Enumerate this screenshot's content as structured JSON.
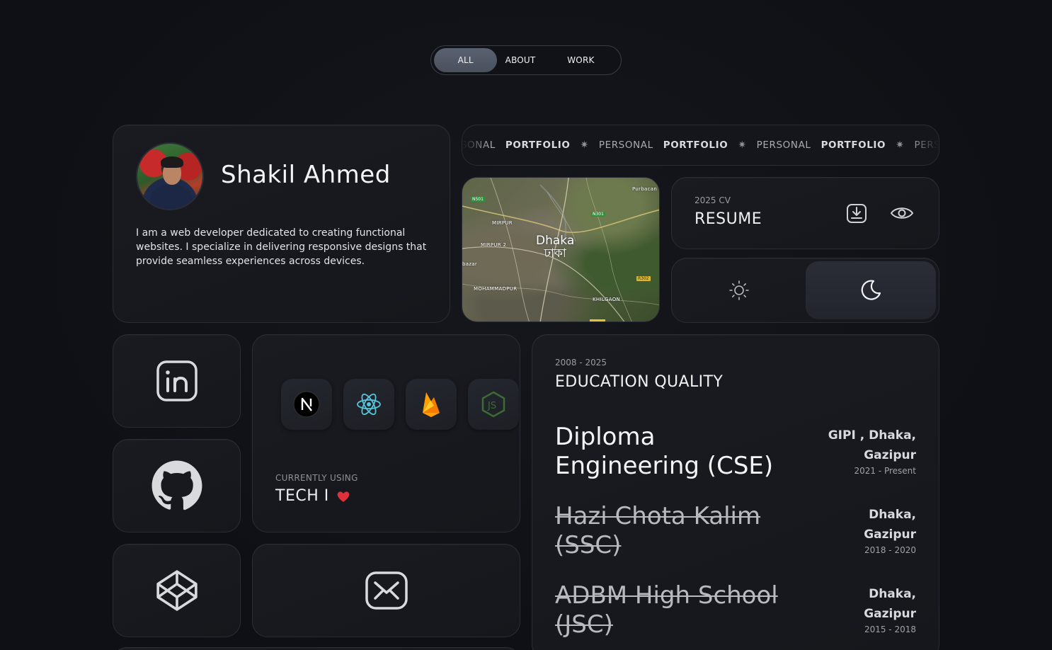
{
  "nav": {
    "items": [
      {
        "label": "ALL",
        "active": true
      },
      {
        "label": "ABOUT",
        "active": false
      },
      {
        "label": "WORK",
        "active": false
      }
    ]
  },
  "profile": {
    "name": "Shakil Ahmed",
    "bio": "I am a web developer dedicated to creating functional websites. I specialize in delivering responsive designs that provide seamless experiences across devices."
  },
  "marquee": {
    "segments": [
      {
        "a": "PERSONAL",
        "b": "PORTFOLIO"
      },
      {
        "a": "PERSONAL",
        "b": "PORTFOLIO"
      },
      {
        "a": "PERSONAL",
        "b": "PORTFOLIO"
      },
      {
        "a": "PERSONAL",
        "b": ""
      }
    ]
  },
  "map": {
    "city_en": "Dhaka",
    "city_bn": "ঢাকা",
    "labels": [
      "Purbacan",
      "MIRPUR",
      "MIRPUR 2",
      "bazar",
      "MOHAMMADPUR",
      "KHILGAON"
    ],
    "road_tags": [
      "N501",
      "N301",
      "R302"
    ]
  },
  "resume": {
    "subtitle": "2025 CV",
    "title": "RESUME",
    "download_icon": "download-icon",
    "view_icon": "eye-icon"
  },
  "theme": {
    "light_icon": "sun-icon",
    "dark_icon": "moon-icon",
    "active": "dark"
  },
  "socials": [
    {
      "name": "linkedin-icon"
    },
    {
      "name": "github-icon"
    },
    {
      "name": "codepen-icon"
    },
    {
      "name": "mail-icon"
    }
  ],
  "tech": {
    "subtitle": "CURRENTLY USING",
    "title": "TECH I",
    "icons": [
      "nextjs-icon",
      "react-icon",
      "firebase-icon",
      "nodejs-icon"
    ]
  },
  "education": {
    "subtitle": "2008 - 2025",
    "title": "EDUCATION QUALITY",
    "entries": [
      {
        "name": "Diploma Engineering (CSE)",
        "place_line1": "GIPI , Dhaka,",
        "place_line2": "Gazipur",
        "years": "2021 - Present",
        "struck": false
      },
      {
        "name": "Hazi Chota Kalim (SSC)",
        "place_line1": "Dhaka,",
        "place_line2": "Gazipur",
        "years": "2018 - 2020",
        "struck": true
      },
      {
        "name": "ADBM High School (JSC)",
        "place_line1": "Dhaka,",
        "place_line2": "Gazipur",
        "years": "2015 - 2018",
        "struck": true
      }
    ]
  },
  "colors": {
    "background": "#0f1116",
    "card": "#17191e",
    "border": "#2a2d35",
    "nav_active": "#545a66",
    "heart": "#e0313b"
  }
}
